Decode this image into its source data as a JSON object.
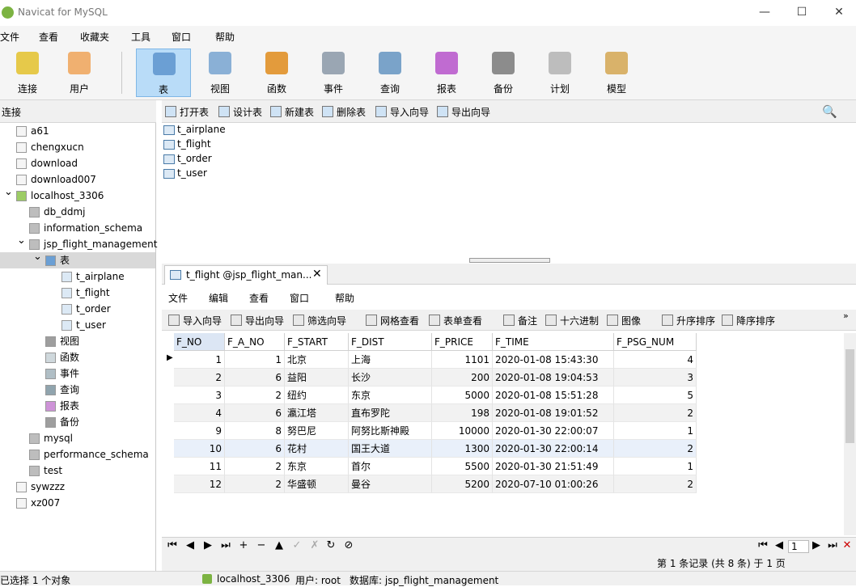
{
  "app": {
    "title": "Navicat for MySQL"
  },
  "menus": [
    "文件",
    "查看",
    "收藏夹",
    "工具",
    "窗口",
    "帮助"
  ],
  "toolbar": [
    {
      "label": "连接",
      "icon": "connection-icon",
      "color": "#e6c94a"
    },
    {
      "label": "用户",
      "icon": "user-icon",
      "color": "#f0b070"
    },
    {
      "label": "表",
      "icon": "table-icon",
      "color": "#6b9fd4",
      "active": true
    },
    {
      "label": "视图",
      "icon": "view-icon",
      "color": "#8ab0d6"
    },
    {
      "label": "函数",
      "icon": "function-icon",
      "color": "#e39b3c"
    },
    {
      "label": "事件",
      "icon": "event-icon",
      "color": "#9aa6b3"
    },
    {
      "label": "查询",
      "icon": "query-icon",
      "color": "#7aa3c9"
    },
    {
      "label": "报表",
      "icon": "report-icon",
      "color": "#c06bd1"
    },
    {
      "label": "备份",
      "icon": "backup-icon",
      "color": "#8c8c8c"
    },
    {
      "label": "计划",
      "icon": "schedule-icon",
      "color": "#bdbdbd"
    },
    {
      "label": "模型",
      "icon": "model-icon",
      "color": "#d9b26a"
    }
  ],
  "connection_header": "连接",
  "tree": [
    {
      "label": "a61",
      "indent": 0,
      "icon": "db-icon"
    },
    {
      "label": "chengxucn",
      "indent": 0,
      "icon": "db-icon"
    },
    {
      "label": "download",
      "indent": 0,
      "icon": "db-icon"
    },
    {
      "label": "download007",
      "indent": 0,
      "icon": "db-icon"
    },
    {
      "label": "localhost_3306",
      "indent": 0,
      "icon": "connection-icon",
      "expanded": true
    },
    {
      "label": "db_ddmj",
      "indent": 1,
      "icon": "database-icon"
    },
    {
      "label": "information_schema",
      "indent": 1,
      "icon": "database-icon"
    },
    {
      "label": "jsp_flight_management",
      "indent": 1,
      "icon": "database-icon",
      "expanded": true
    },
    {
      "label": "表",
      "indent": 2,
      "icon": "tables-folder-icon",
      "expanded": true,
      "selected": true
    },
    {
      "label": "t_airplane",
      "indent": 3,
      "icon": "table-icon"
    },
    {
      "label": "t_flight",
      "indent": 3,
      "icon": "table-icon"
    },
    {
      "label": "t_order",
      "indent": 3,
      "icon": "table-icon"
    },
    {
      "label": "t_user",
      "indent": 3,
      "icon": "table-icon"
    },
    {
      "label": "视图",
      "indent": 2,
      "icon": "view-icon"
    },
    {
      "label": "函数",
      "indent": 2,
      "icon": "function-icon"
    },
    {
      "label": "事件",
      "indent": 2,
      "icon": "event-icon"
    },
    {
      "label": "查询",
      "indent": 2,
      "icon": "query-icon"
    },
    {
      "label": "报表",
      "indent": 2,
      "icon": "report-icon"
    },
    {
      "label": "备份",
      "indent": 2,
      "icon": "backup-icon"
    },
    {
      "label": "mysql",
      "indent": 1,
      "icon": "database-icon"
    },
    {
      "label": "performance_schema",
      "indent": 1,
      "icon": "database-icon"
    },
    {
      "label": "test",
      "indent": 1,
      "icon": "database-icon"
    },
    {
      "label": "sywzzz",
      "indent": 0,
      "icon": "db-icon"
    },
    {
      "label": "xz007",
      "indent": 0,
      "icon": "db-icon"
    }
  ],
  "object_toolbar": [
    "打开表",
    "设计表",
    "新建表",
    "删除表",
    "导入向导",
    "导出向导"
  ],
  "objects": [
    "t_airplane",
    "t_flight",
    "t_order",
    "t_user"
  ],
  "tab": {
    "label": "t_flight @jsp_flight_man...",
    "close": "✕"
  },
  "inner_menu": [
    "文件",
    "编辑",
    "查看",
    "窗口",
    "帮助"
  ],
  "inner_toolbar": [
    "导入向导",
    "导出向导",
    "筛选向导",
    "网格查看",
    "表单查看",
    "备注",
    "十六进制",
    "图像",
    "升序排序",
    "降序排序"
  ],
  "grid": {
    "columns": [
      "F_NO",
      "F_A_NO",
      "F_START",
      "F_DIST",
      "F_PRICE",
      "F_TIME",
      "F_PSG_NUM"
    ],
    "rows": [
      [
        "1",
        "1",
        "北京",
        "上海",
        "1101",
        "2020-01-08 15:43:30",
        "4"
      ],
      [
        "2",
        "6",
        "益阳",
        "长沙",
        "200",
        "2020-01-08 19:04:53",
        "3"
      ],
      [
        "3",
        "2",
        "纽约",
        "东京",
        "5000",
        "2020-01-08 15:51:28",
        "5"
      ],
      [
        "4",
        "6",
        "瀛江塔",
        "直布罗陀",
        "198",
        "2020-01-08 19:01:52",
        "2"
      ],
      [
        "9",
        "8",
        "努巴尼",
        "阿努比斯神殿",
        "10000",
        "2020-01-30 22:00:07",
        "1"
      ],
      [
        "10",
        "6",
        "花村",
        "国王大道",
        "1300",
        "2020-01-30 22:00:14",
        "2"
      ],
      [
        "11",
        "2",
        "东京",
        "首尔",
        "5500",
        "2020-01-30 21:51:49",
        "1"
      ],
      [
        "12",
        "2",
        "华盛顿",
        "曼谷",
        "5200",
        "2020-07-10 01:00:26",
        "2"
      ]
    ]
  },
  "nav": {
    "page": "1",
    "record_info": "第 1 条记录 (共 8 条) 于 1 页"
  },
  "status": {
    "left": "已选择 1 个对象",
    "connection": "localhost_3306",
    "user": "用户: root",
    "database": "数据库: jsp_flight_management"
  }
}
